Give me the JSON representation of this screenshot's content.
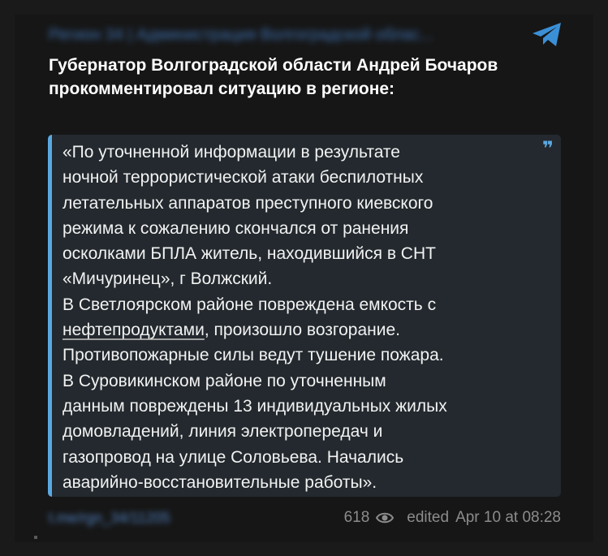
{
  "post": {
    "channel_name": "Регион 34 | Администрация Волгоградской облас...",
    "headline_line1": "Губернатор Волгоградской области Андрей Бочаров",
    "headline_line2": "прокомментировал ситуацию в регионе:",
    "quote_lines": [
      "«По уточненной информации в результате",
      "ночной террористической атаки беспилотных",
      "летательных аппаратов преступного киевского",
      "режима к сожалению скончался от ранения",
      "осколками БПЛА житель, находившийся в СНТ",
      "«Мичуринец», г Волжский.",
      "В Светлоярском районе повреждена емкость с"
    ],
    "quote_link": "нефтепродуктами",
    "quote_link_rest": ", произошло возгорание.",
    "quote_lines_after": [
      "Противопожарные силы ведут тушение пожара.",
      "В Суровикинском районе по уточненным",
      "данным повреждены 13 индивидуальных жилых",
      "домовладений, линия электропередач и",
      "газопровод на улице Соловьева. Начались",
      "аварийно-восстановительные работы»."
    ],
    "quote_mark": "❞",
    "signature": "t.me/rgn_34/11205",
    "views": "618",
    "edited_label": "edited",
    "date_time": "Apr 10 at 08:28"
  },
  "icons": {
    "telegram": "telegram-icon",
    "views": "eye-icon",
    "quote": "quote-icon"
  },
  "colors": {
    "accent": "#5ba8e0",
    "background": "#161616",
    "quote_background": "#23292e"
  }
}
